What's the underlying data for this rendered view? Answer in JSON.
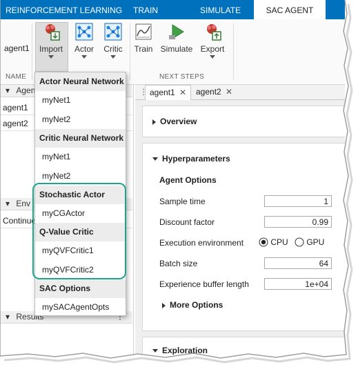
{
  "tabs": [
    {
      "label": "REINFORCEMENT LEARNING"
    },
    {
      "label": "TRAIN"
    },
    {
      "label": "SIMULATE"
    },
    {
      "label": "SAC AGENT"
    }
  ],
  "ribbon": {
    "agent_name": "agent1",
    "name_section": "NAME",
    "import_label": "Import",
    "actor_label": "Actor",
    "critic_label": "Critic",
    "train_label": "Train",
    "simulate_label": "Simulate",
    "export_label": "Export",
    "next_steps_section": "NEXT STEPS"
  },
  "left_panel": {
    "agents_header": "Agen",
    "agents": [
      "agent1",
      "agent2"
    ],
    "env_header": "Env",
    "env_item": "Continue",
    "results_header": "Results"
  },
  "menu": {
    "sections": [
      {
        "header": "Actor Neural Network",
        "items": [
          "myNet1",
          "myNet2"
        ]
      },
      {
        "header": "Critic Neural Network",
        "items": [
          "myNet1",
          "myNet2"
        ]
      },
      {
        "header": "Stochastic Actor",
        "items": [
          "myCGActor"
        ]
      },
      {
        "header": "Q-Value Critic",
        "items": [
          "myQVFCritic1",
          "myQVFCritic2"
        ]
      },
      {
        "header": "SAC Options",
        "items": [
          "mySACAgentOpts"
        ]
      }
    ]
  },
  "document": {
    "tabs": [
      "agent1",
      "agent2"
    ],
    "overview": "Overview",
    "hyperparameters": "Hyperparameters",
    "agent_options": "Agent Options",
    "sample_time_label": "Sample time",
    "sample_time": "1",
    "discount_label": "Discount factor",
    "discount": "0.99",
    "exec_env_label": "Execution environment",
    "cpu": "CPU",
    "gpu": "GPU",
    "batch_label": "Batch size",
    "batch": "64",
    "buffer_label": "Experience buffer length",
    "buffer": "1e+04",
    "more_options": "More Options",
    "exploration": "Exploration"
  },
  "colors": {
    "tab_bar": "#0072bd",
    "highlight": "#1ca58a"
  }
}
